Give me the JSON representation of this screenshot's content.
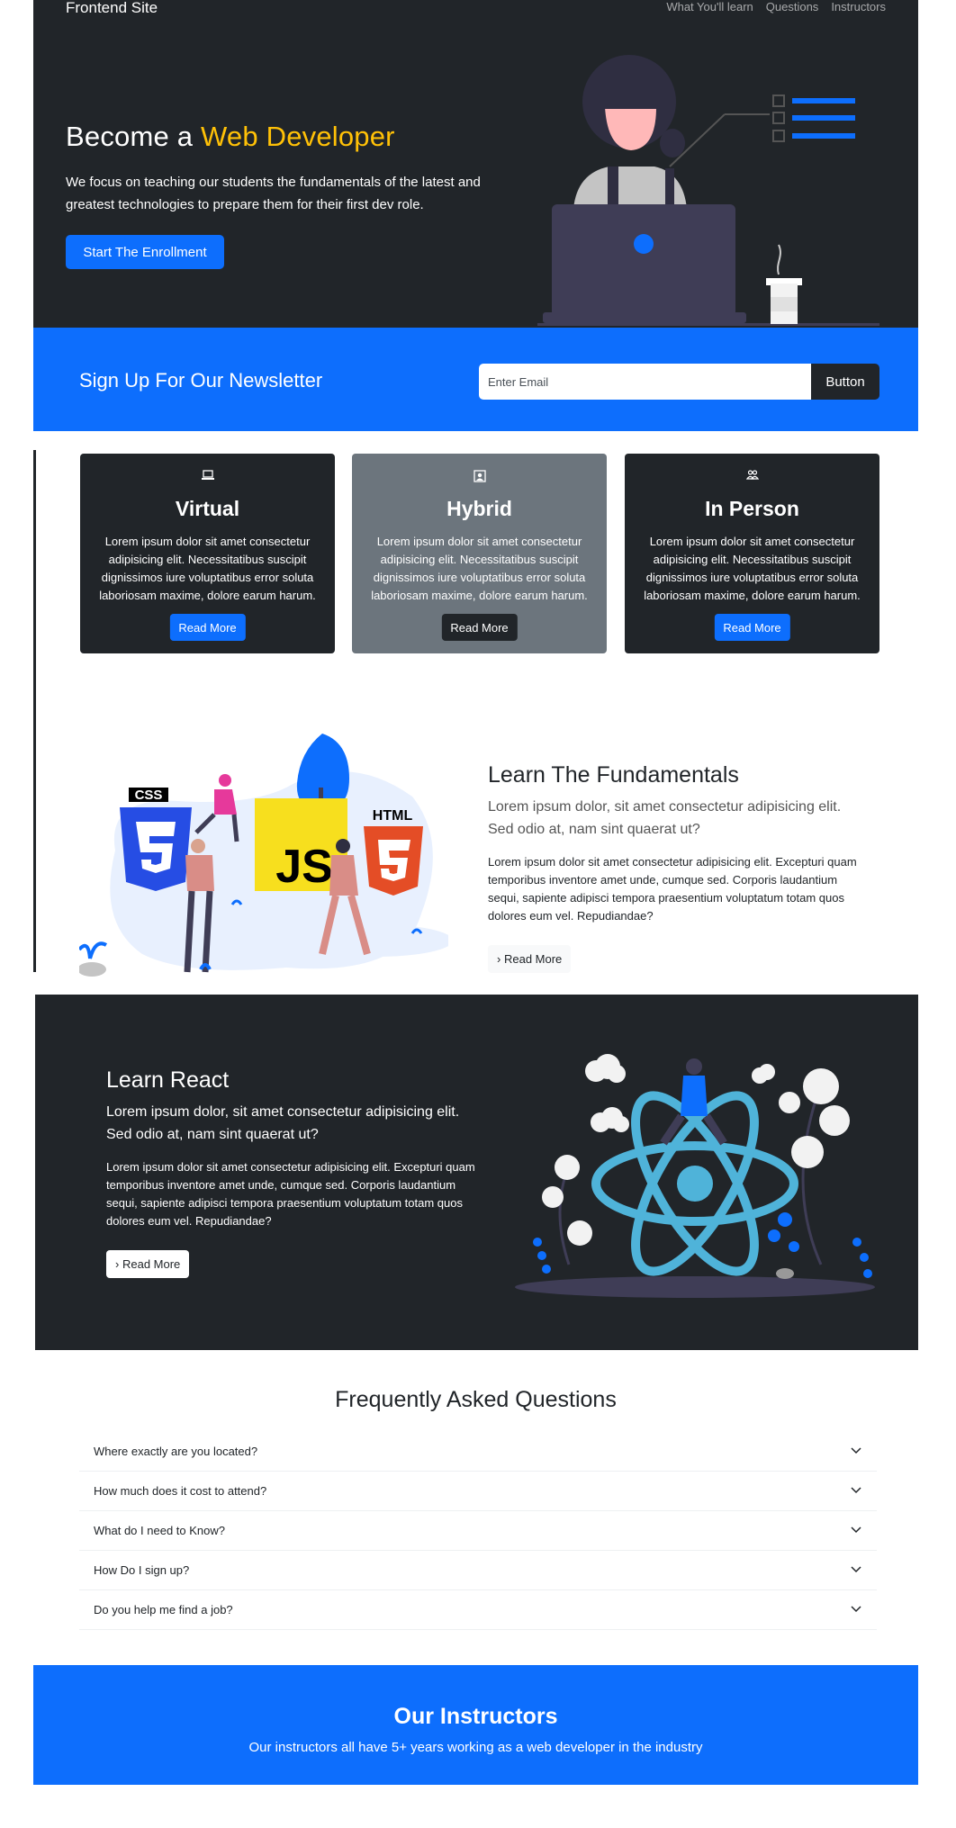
{
  "nav": {
    "brand": "Frontend Site",
    "links": [
      "What You'll learn",
      "Questions",
      "Instructors"
    ]
  },
  "hero": {
    "title_prefix": "Become a",
    "title_accent": "Web Developer",
    "description": "We focus on teaching our students the fundamentals of the latest and greatest technologies to prepare them for their first dev role.",
    "cta_label": "Start The Enrollment"
  },
  "newsletter": {
    "title": "Sign Up For Our Newsletter",
    "email_placeholder": "Enter Email",
    "button_label": "Button"
  },
  "cards": [
    {
      "icon": "laptop-icon",
      "title": "Virtual",
      "text": "Lorem ipsum dolor sit amet consectetur adipisicing elit. Necessitatibus suscipit dignissimos iure voluptatibus error soluta laboriosam maxime, dolore earum harum.",
      "button": "Read More",
      "bg": "#212529",
      "btn_bg": "#0d6efd"
    },
    {
      "icon": "person-badge-icon",
      "title": "Hybrid",
      "text": "Lorem ipsum dolor sit amet consectetur adipisicing elit. Necessitatibus suscipit dignissimos iure voluptatibus error soluta laboriosam maxime, dolore earum harum.",
      "button": "Read More",
      "bg": "#6c757d",
      "btn_bg": "#212529"
    },
    {
      "icon": "people-icon",
      "title": "In Person",
      "text": "Lorem ipsum dolor sit amet consectetur adipisicing elit. Necessitatibus suscipit dignissimos iure voluptatibus error soluta laboriosam maxime, dolore earum harum.",
      "button": "Read More",
      "bg": "#212529",
      "btn_bg": "#0d6efd"
    }
  ],
  "fundamentals": {
    "title": "Learn The Fundamentals",
    "lead": "Lorem ipsum dolor, sit amet consectetur adipisicing elit. Sed odio at, nam sint quaerat ut?",
    "body": "Lorem ipsum dolor sit amet consectetur adipisicing elit. Excepturi quam temporibus inventore amet unde, cumque sed. Corporis laudantium sequi, sapiente adipisci tempora praesentium voluptatum totam quos dolores eum vel. Repudiandae?",
    "button": "Read More",
    "illus_labels": {
      "css": "CSS",
      "js": "JS",
      "html": "HTML"
    }
  },
  "react": {
    "title": "Learn React",
    "lead": "Lorem ipsum dolor, sit amet consectetur adipisicing elit. Sed odio at, nam sint quaerat ut?",
    "body": "Lorem ipsum dolor sit amet consectetur adipisicing elit. Excepturi quam temporibus inventore amet unde, cumque sed. Corporis laudantium sequi, sapiente adipisci tempora praesentium voluptatum totam quos dolores eum vel. Repudiandae?",
    "button": "Read More"
  },
  "faq": {
    "title": "Frequently Asked Questions",
    "items": [
      "Where exactly are you located?",
      "How much does it cost to attend?",
      "What do I need to Know?",
      "How Do I sign up?",
      "Do you help me find a job?"
    ]
  },
  "instructors": {
    "title": "Our Instructors",
    "subtitle": "Our instructors all have 5+ years working as a web developer in the industry"
  },
  "colors": {
    "dark": "#212529",
    "primary": "#0d6efd",
    "warning": "#ffc107",
    "secondary": "#6c757d"
  }
}
